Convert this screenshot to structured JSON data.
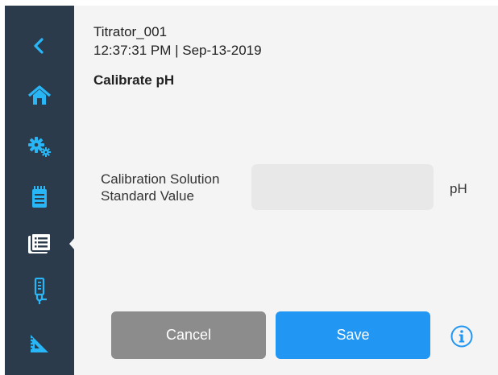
{
  "header": {
    "device_name": "Titrator_001",
    "timestamp": "12:37:31 PM | Sep-13-2019",
    "page_title": "Calibrate pH"
  },
  "sidebar": {
    "items": [
      {
        "icon": "back-arrow-icon"
      },
      {
        "icon": "home-icon"
      },
      {
        "icon": "settings-gears-icon"
      },
      {
        "icon": "notepad-icon"
      },
      {
        "icon": "method-list-icon",
        "active": true
      },
      {
        "icon": "electrode-icon"
      },
      {
        "icon": "calibration-ruler-icon"
      }
    ]
  },
  "form": {
    "label_line1": "Calibration Solution",
    "label_line2": "Standard Value",
    "value": "",
    "unit": "pH"
  },
  "buttons": {
    "cancel": "Cancel",
    "save": "Save"
  },
  "colors": {
    "sidebar_bg": "#2c3b4b",
    "accent": "#29b6f6",
    "primary": "#2196f3",
    "secondary": "#8c8c8c"
  }
}
